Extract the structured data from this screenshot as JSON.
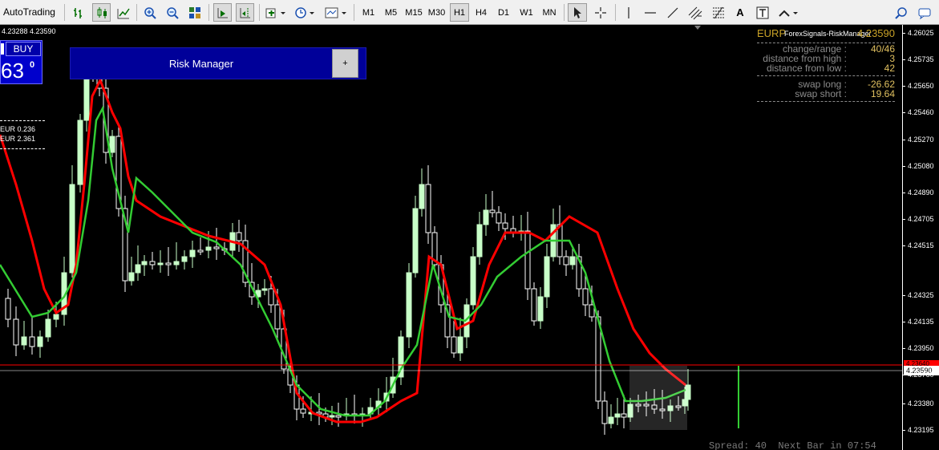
{
  "toolbar": {
    "autotrading_label": "AutoTrading",
    "timeframes": [
      "M1",
      "M5",
      "M15",
      "M30",
      "H1",
      "H4",
      "D1",
      "W1",
      "MN"
    ],
    "active_timeframe": "H1",
    "text_tool_label": "A"
  },
  "chart": {
    "ohlc_text": "4.23288 4.23590",
    "colors": {
      "bull_candle": "#c8ffc8",
      "bear_candle": "#ffffff",
      "slow_ma": "#ff0000",
      "fast_ma": "#33cc33",
      "bid_line": "#ffffff",
      "ask_line": "#ff0000"
    }
  },
  "buy_panel": {
    "label": "BUY",
    "price_big": "63",
    "price_sup": "0"
  },
  "eur_info": {
    "line1": "EUR 0.236",
    "line2": "EUR 2.361"
  },
  "risk_manager": {
    "title": "Risk Manager",
    "plus_label": "+"
  },
  "stats": {
    "symbol": "EURP",
    "indicator_name": "ForexSignals-RiskManager",
    "bid": "4.23590",
    "rows": [
      {
        "label": "change/range :",
        "value": "40/46",
        "value_color": "#e0c060"
      },
      {
        "label": "distance from high :",
        "value": "3",
        "value_color": "#e0c060"
      },
      {
        "label": "distance from low :",
        "value": "42",
        "value_color": "#e0c060"
      },
      {
        "label": "swap long :",
        "value": "-26.62",
        "value_color": "#e0c060"
      },
      {
        "label": "swap short :",
        "value": "19.64",
        "value_color": "#e0c060"
      }
    ]
  },
  "axis": {
    "prices": [
      "4.26025",
      "4.25735",
      "4.25650",
      "4.25460",
      "4.25270",
      "4.25080",
      "4.24890",
      "4.24705",
      "4.24515",
      "4.24325",
      "4.24135",
      "4.23950",
      "4.23760",
      "4.23380",
      "4.23195"
    ],
    "current_price": "4.23590",
    "ask_price": "4.23640"
  },
  "status": {
    "spread_text": "Spread: 40  Next Bar in 07:54"
  }
}
